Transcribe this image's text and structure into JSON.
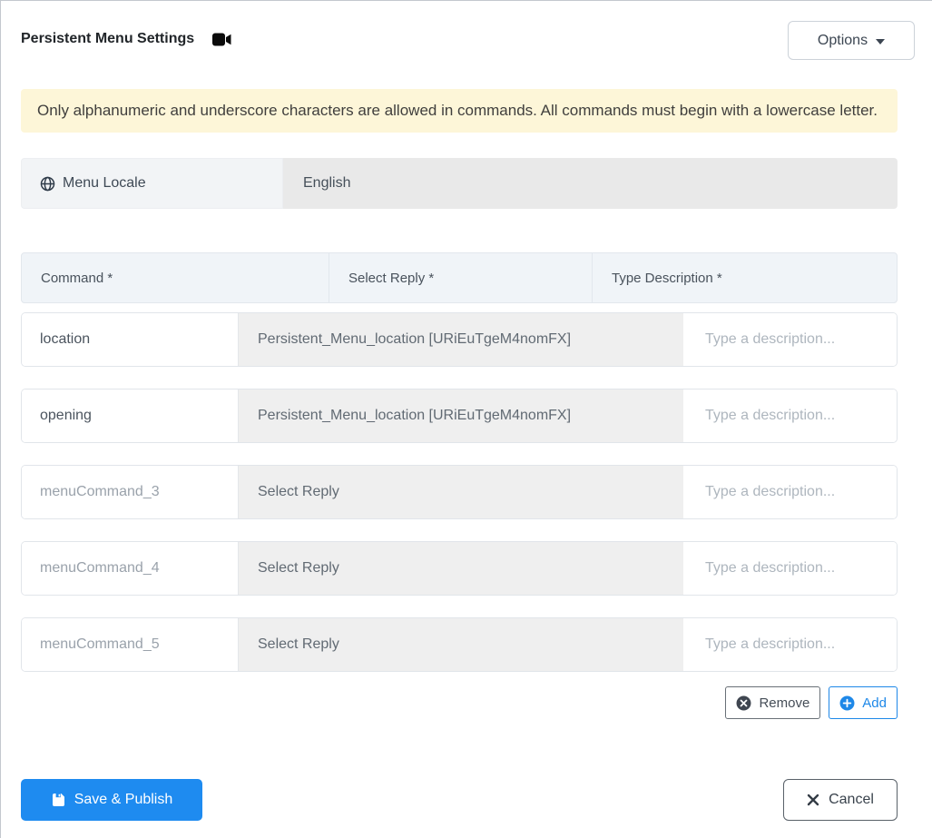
{
  "header": {
    "title": "Persistent Menu Settings",
    "options_label": "Options"
  },
  "alert": {
    "text": "Only alphanumeric and underscore characters are allowed in commands. All commands must begin with a lowercase letter.",
    "background": "#fdf6d8"
  },
  "locale": {
    "label": "Menu Locale",
    "value": "English"
  },
  "table": {
    "headers": [
      "Command *",
      "Select Reply *",
      "Type Description *"
    ],
    "description_placeholder": "Type a description...",
    "rows": [
      {
        "command": "location",
        "command_is_placeholder": false,
        "reply": "Persistent_Menu_location [URiEuTgeM4nomFX]"
      },
      {
        "command": "opening",
        "command_is_placeholder": false,
        "reply": "Persistent_Menu_location [URiEuTgeM4nomFX]"
      },
      {
        "command": "menuCommand_3",
        "command_is_placeholder": true,
        "reply": "Select Reply"
      },
      {
        "command": "menuCommand_4",
        "command_is_placeholder": true,
        "reply": "Select Reply"
      },
      {
        "command": "menuCommand_5",
        "command_is_placeholder": true,
        "reply": "Select Reply"
      }
    ]
  },
  "actions": {
    "remove_label": "Remove",
    "add_label": "Add"
  },
  "footer": {
    "save_label": "Save & Publish",
    "cancel_label": "Cancel"
  },
  "colors": {
    "primary": "#1e8bf0",
    "danger_icon": "#3f4650"
  }
}
